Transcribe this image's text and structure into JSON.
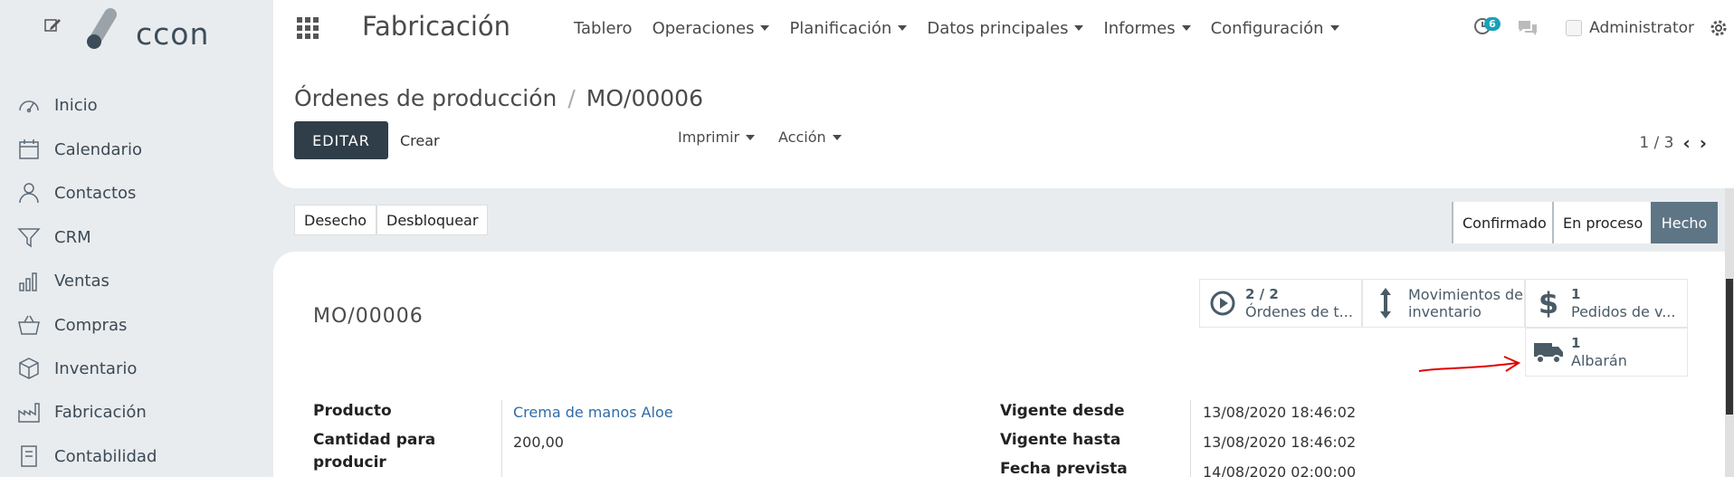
{
  "sidebar": {
    "logo_text": "ccon",
    "items": [
      {
        "label": "Inicio",
        "icon": "dashboard-icon"
      },
      {
        "label": "Calendario",
        "icon": "calendar-icon"
      },
      {
        "label": "Contactos",
        "icon": "user-icon"
      },
      {
        "label": "CRM",
        "icon": "filter-icon"
      },
      {
        "label": "Ventas",
        "icon": "bar-chart-icon"
      },
      {
        "label": "Compras",
        "icon": "basket-icon"
      },
      {
        "label": "Inventario",
        "icon": "box-icon"
      },
      {
        "label": "Fabricación",
        "icon": "factory-icon"
      },
      {
        "label": "Contabilidad",
        "icon": "invoice-icon"
      }
    ]
  },
  "topbar": {
    "brand": "Fabricación",
    "menu": [
      {
        "label": "Tablero",
        "dropdown": false
      },
      {
        "label": "Operaciones",
        "dropdown": true
      },
      {
        "label": "Planificación",
        "dropdown": true
      },
      {
        "label": "Datos principales",
        "dropdown": true
      },
      {
        "label": "Informes",
        "dropdown": true
      },
      {
        "label": "Configuración",
        "dropdown": true
      }
    ],
    "activity_count": "6",
    "user": "Administrator"
  },
  "control_panel": {
    "breadcrumb_parent": "Órdenes de producción",
    "breadcrumb_sep": "/",
    "breadcrumb_current": "MO/00006",
    "edit_label": "EDITAR",
    "create_label": "Crear",
    "print_label": "Imprimir",
    "action_label": "Acción",
    "pager_value": "1 / 3"
  },
  "statusbar": {
    "buttons": [
      "Desecho",
      "Desbloquear"
    ],
    "stages": [
      {
        "label": "Confirmado",
        "active": false
      },
      {
        "label": "En proceso",
        "active": false
      },
      {
        "label": "Hecho",
        "active": true
      }
    ]
  },
  "form": {
    "name": "MO/00006",
    "smart_buttons": {
      "work_orders_count": "2 / 2",
      "work_orders_label": "Órdenes de t...",
      "moves_label_1": "Movimientos de",
      "moves_label_2": "inventario",
      "sales_count": "1",
      "sales_label": "Pedidos de v...",
      "picking_count": "1",
      "picking_label": "Albarán"
    },
    "fields_left": {
      "product_label": "Producto",
      "product_value": "Crema de manos Aloe",
      "qty_label_1": "Cantidad para",
      "qty_label_2": "producir",
      "qty_value": "200,00"
    },
    "fields_right": {
      "from_label": "Vigente desde",
      "from_value": "13/08/2020 18:46:02",
      "to_label": "Vigente hasta",
      "to_value": "13/08/2020 18:46:02",
      "planned_label": "Fecha prevista",
      "planned_value": "14/08/2020 02:00:00"
    }
  },
  "colors": {
    "primary_button": "#2f3e48",
    "active_stage": "#5e7585",
    "link": "#2f6ba8",
    "badge": "#17a2b8",
    "annotation_arrow": "#e00000"
  }
}
